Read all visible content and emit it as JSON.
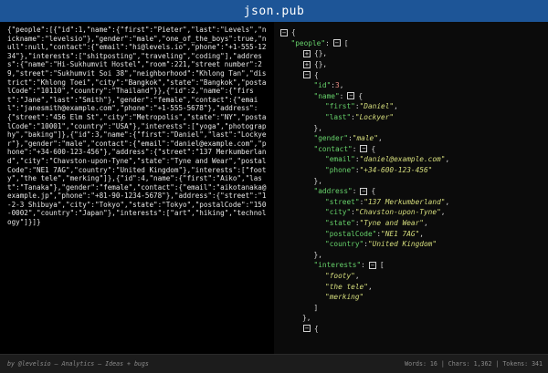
{
  "header": {
    "title": "json.pub"
  },
  "editor": {
    "raw_json": "{\"people\":[{\"id\":1,\"name\":{\"first\":\"Pieter\",\"last\":\"Levels\",\"nickname\":\"levelsio\"},\"gender\":\"male\",\"one_of_the_boys\":true,\"null\":null,\"contact\":{\"email\":\"hi@levels.io\",\"phone\":\"+1-555-1234\"},\"interests\":[\"shitposting\",\"traveling\",\"coding\"],\"address\":{\"name\":\"Hi-Sukhumvit Hostel\",\"room\":221,\"street number\":29,\"street\":\"Sukhumvit Soi 38\",\"neighborhood\":\"Khlong Tan\",\"district\":\"Khlong Toei\",\"city\":\"Bangkok\",\"state\":\"Bangkok\",\"postalCode\":\"10110\",\"country\":\"Thailand\"}},{\"id\":2,\"name\":{\"first\":\"Jane\",\"last\":\"Smith\"},\"gender\":\"female\",\"contact\":{\"email\":\"janesmith@example.com\",\"phone\":\"+1-555-5678\"},\"address\":{\"street\":\"456 Elm St\",\"city\":\"Metropolis\",\"state\":\"NY\",\"postalCode\":\"10001\",\"country\":\"USA\"},\"interests\":[\"yoga\",\"photography\",\"baking\"]},{\"id\":3,\"name\":{\"first\":\"Daniel\",\"last\":\"Lockyer\"},\"gender\":\"male\",\"contact\":{\"email\":\"daniel@example.com\",\"phone\":\"+34-600-123-456\"},\"address\":{\"street\":\"137 Merkumberland\",\"city\":\"Chavston-upon-Tyne\",\"state\":\"Tyne and Wear\",\"postalCode\":\"NE1 7AG\",\"country\":\"United Kingdom\"},\"interests\":[\"footy\",\"the tele\",\"merking\"]},{\"id\":4,\"name\":{\"first\":\"Aiko\",\"last\":\"Tanaka\"},\"gender\":\"female\",\"contact\":{\"email\":\"aikotanaka@example.jp\",\"phone\":\"+81-90-1234-5678\"},\"address\":{\"street\":\"1-2-3 Shibuya\",\"city\":\"Tokyo\",\"state\":\"Tokyo\",\"postalCode\":\"150-0002\",\"country\":\"Japan\"},\"interests\":[\"art\",\"hiking\",\"technology\"]}]}"
  },
  "tree": {
    "lines": [
      {
        "indent": 0,
        "toggle": "minus",
        "parts": [
          {
            "t": "p",
            "v": "{"
          }
        ]
      },
      {
        "indent": 1,
        "toggle": null,
        "parts": [
          {
            "t": "k",
            "v": "\"people\""
          },
          {
            "t": "p",
            "v": ":"
          }
        ],
        "toggle_after": "minus",
        "after": [
          {
            "t": "p",
            "v": "["
          }
        ]
      },
      {
        "indent": 2,
        "toggle": "plus",
        "parts": [
          {
            "t": "p",
            "v": "{},"
          }
        ]
      },
      {
        "indent": 2,
        "toggle": "plus",
        "parts": [
          {
            "t": "p",
            "v": "{},"
          }
        ]
      },
      {
        "indent": 2,
        "toggle": "minus",
        "parts": [
          {
            "t": "p",
            "v": "{"
          }
        ]
      },
      {
        "indent": 3,
        "toggle": null,
        "parts": [
          {
            "t": "k",
            "v": "\"id\""
          },
          {
            "t": "p",
            "v": ": "
          },
          {
            "t": "n",
            "v": "3"
          },
          {
            "t": "p",
            "v": ","
          }
        ]
      },
      {
        "indent": 3,
        "toggle": null,
        "parts": [
          {
            "t": "k",
            "v": "\"name\""
          },
          {
            "t": "p",
            "v": ":"
          }
        ],
        "toggle_after": "minus",
        "after": [
          {
            "t": "p",
            "v": "{"
          }
        ]
      },
      {
        "indent": 4,
        "toggle": null,
        "parts": [
          {
            "t": "k",
            "v": "\"first\""
          },
          {
            "t": "p",
            "v": ": "
          },
          {
            "t": "s",
            "v": "\"Daniel\""
          },
          {
            "t": "p",
            "v": ","
          }
        ]
      },
      {
        "indent": 4,
        "toggle": null,
        "parts": [
          {
            "t": "k",
            "v": "\"last\""
          },
          {
            "t": "p",
            "v": ": "
          },
          {
            "t": "s",
            "v": "\"Lockyer\""
          }
        ]
      },
      {
        "indent": 3,
        "toggle": null,
        "parts": [
          {
            "t": "p",
            "v": "},"
          }
        ]
      },
      {
        "indent": 3,
        "toggle": null,
        "parts": [
          {
            "t": "k",
            "v": "\"gender\""
          },
          {
            "t": "p",
            "v": ": "
          },
          {
            "t": "s",
            "v": "\"male\""
          },
          {
            "t": "p",
            "v": ","
          }
        ]
      },
      {
        "indent": 3,
        "toggle": null,
        "parts": [
          {
            "t": "k",
            "v": "\"contact\""
          },
          {
            "t": "p",
            "v": ":"
          }
        ],
        "toggle_after": "minus",
        "after": [
          {
            "t": "p",
            "v": "{"
          }
        ]
      },
      {
        "indent": 4,
        "toggle": null,
        "parts": [
          {
            "t": "k",
            "v": "\"email\""
          },
          {
            "t": "p",
            "v": ": "
          },
          {
            "t": "s",
            "v": "\"daniel@example.com\""
          },
          {
            "t": "p",
            "v": ","
          }
        ]
      },
      {
        "indent": 4,
        "toggle": null,
        "parts": [
          {
            "t": "k",
            "v": "\"phone\""
          },
          {
            "t": "p",
            "v": ": "
          },
          {
            "t": "s",
            "v": "\"+34-600-123-456\""
          }
        ]
      },
      {
        "indent": 3,
        "toggle": null,
        "parts": [
          {
            "t": "p",
            "v": "},"
          }
        ]
      },
      {
        "indent": 3,
        "toggle": null,
        "parts": [
          {
            "t": "k",
            "v": "\"address\""
          },
          {
            "t": "p",
            "v": ":"
          }
        ],
        "toggle_after": "minus",
        "after": [
          {
            "t": "p",
            "v": "{"
          }
        ]
      },
      {
        "indent": 4,
        "toggle": null,
        "parts": [
          {
            "t": "k",
            "v": "\"street\""
          },
          {
            "t": "p",
            "v": ": "
          },
          {
            "t": "s",
            "v": "\"137 Merkumberland\""
          },
          {
            "t": "p",
            "v": ","
          }
        ]
      },
      {
        "indent": 4,
        "toggle": null,
        "parts": [
          {
            "t": "k",
            "v": "\"city\""
          },
          {
            "t": "p",
            "v": ": "
          },
          {
            "t": "s",
            "v": "\"Chavston-upon-Tyne\""
          },
          {
            "t": "p",
            "v": ","
          }
        ]
      },
      {
        "indent": 4,
        "toggle": null,
        "parts": [
          {
            "t": "k",
            "v": "\"state\""
          },
          {
            "t": "p",
            "v": ": "
          },
          {
            "t": "s",
            "v": "\"Tyne and Wear\""
          },
          {
            "t": "p",
            "v": ","
          }
        ]
      },
      {
        "indent": 4,
        "toggle": null,
        "parts": [
          {
            "t": "k",
            "v": "\"postalCode\""
          },
          {
            "t": "p",
            "v": ": "
          },
          {
            "t": "s",
            "v": "\"NE1 7AG\""
          },
          {
            "t": "p",
            "v": ","
          }
        ]
      },
      {
        "indent": 4,
        "toggle": null,
        "parts": [
          {
            "t": "k",
            "v": "\"country\""
          },
          {
            "t": "p",
            "v": ": "
          },
          {
            "t": "s",
            "v": "\"United Kingdom\""
          }
        ]
      },
      {
        "indent": 3,
        "toggle": null,
        "parts": [
          {
            "t": "p",
            "v": "},"
          }
        ]
      },
      {
        "indent": 3,
        "toggle": null,
        "parts": [
          {
            "t": "k",
            "v": "\"interests\""
          },
          {
            "t": "p",
            "v": ":"
          }
        ],
        "toggle_after": "minus",
        "after": [
          {
            "t": "p",
            "v": "["
          }
        ]
      },
      {
        "indent": 4,
        "toggle": null,
        "parts": [
          {
            "t": "s",
            "v": "\"footy\""
          },
          {
            "t": "p",
            "v": ","
          }
        ]
      },
      {
        "indent": 4,
        "toggle": null,
        "parts": [
          {
            "t": "s",
            "v": "\"the tele\""
          },
          {
            "t": "p",
            "v": ","
          }
        ]
      },
      {
        "indent": 4,
        "toggle": null,
        "parts": [
          {
            "t": "s",
            "v": "\"merking\""
          }
        ]
      },
      {
        "indent": 3,
        "toggle": null,
        "parts": [
          {
            "t": "p",
            "v": "]"
          }
        ]
      },
      {
        "indent": 2,
        "toggle": null,
        "parts": [
          {
            "t": "p",
            "v": "},"
          }
        ]
      },
      {
        "indent": 2,
        "toggle": "minus",
        "parts": [
          {
            "t": "p",
            "v": "{"
          }
        ]
      }
    ]
  },
  "footer": {
    "credit": "by @levelsio — Analytics — Ideas + bugs",
    "stats": "Words: 16 | Chars: 1,362 | Tokens: 341"
  },
  "colors": {
    "header_bg": "#1d5597",
    "key": "#67d36b",
    "string": "#d6de7d",
    "number": "#e88b83"
  }
}
